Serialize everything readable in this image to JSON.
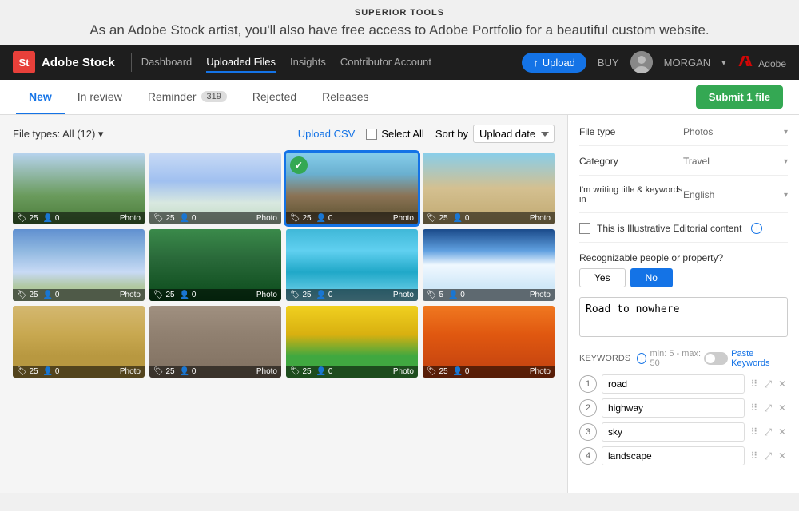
{
  "brand": {
    "title": "SUPERIOR TOOLS",
    "tagline": "As an Adobe Stock artist, you'll also have free access to Adobe Portfolio for a beautiful custom website.",
    "app_logo": "St",
    "app_name": "Adobe Stock",
    "adobe_label": "Adobe"
  },
  "navbar": {
    "links": [
      {
        "label": "Dashboard",
        "active": false
      },
      {
        "label": "Uploaded Files",
        "active": true
      },
      {
        "label": "Insights",
        "active": false
      },
      {
        "label": "Contributor Account",
        "active": false
      }
    ],
    "upload_btn": "Upload",
    "buy_label": "BUY",
    "user_name": "MORGAN"
  },
  "tabs": {
    "items": [
      {
        "label": "New",
        "active": true,
        "badge": null
      },
      {
        "label": "In review",
        "active": false,
        "badge": null
      },
      {
        "label": "Reminder",
        "active": false,
        "badge": "319"
      },
      {
        "label": "Rejected",
        "active": false,
        "badge": null
      },
      {
        "label": "Releases",
        "active": false,
        "badge": null
      }
    ],
    "submit_btn": "Submit 1 file"
  },
  "toolbar": {
    "file_types": "File types: All (12) ▾",
    "upload_csv": "Upload CSV",
    "select_all": "Select All",
    "sort_by": "Sort by",
    "sort_option": "Upload date"
  },
  "images": [
    {
      "id": 1,
      "color": "img-trees",
      "tags": 25,
      "people": 0,
      "type": "Photo"
    },
    {
      "id": 2,
      "color": "img-skydive",
      "tags": 25,
      "people": 0,
      "type": "Photo"
    },
    {
      "id": 3,
      "color": "img-road",
      "tags": 25,
      "people": 0,
      "type": "Photo",
      "selected": true,
      "checked": true
    },
    {
      "id": 4,
      "color": "img-desert",
      "tags": 25,
      "people": 0,
      "type": "Photo"
    },
    {
      "id": 5,
      "color": "img-clouds",
      "tags": 25,
      "people": 0,
      "type": "Photo"
    },
    {
      "id": 6,
      "color": "img-palms",
      "tags": 25,
      "people": 0,
      "type": "Photo"
    },
    {
      "id": 7,
      "color": "img-pool",
      "tags": 25,
      "people": 0,
      "type": "Photo"
    },
    {
      "id": 8,
      "color": "img-ski",
      "tags": 5,
      "people": 0,
      "type": "Photo"
    },
    {
      "id": 9,
      "color": "img-room",
      "tags": 25,
      "people": 0,
      "type": "Photo"
    },
    {
      "id": 10,
      "color": "img-stone",
      "tags": 25,
      "people": 0,
      "type": "Photo"
    },
    {
      "id": 11,
      "color": "img-yellow",
      "tags": 25,
      "people": 0,
      "type": "Photo"
    },
    {
      "id": 12,
      "color": "img-orange",
      "tags": 25,
      "people": 0,
      "type": "Photo"
    }
  ],
  "right_panel": {
    "file_type_label": "File type",
    "file_type_value": "Photos",
    "category_label": "Category",
    "category_value": "Travel",
    "lang_label": "I'm writing title & keywords in",
    "lang_value": "English",
    "editorial_label": "This is Illustrative Editorial content",
    "recognizable_label": "Recognizable people or property?",
    "yes_btn": "Yes",
    "no_btn": "No",
    "title_placeholder": "Road to nowhere",
    "keywords_label": "KEYWORDS",
    "keywords_hint": "min: 5 - max: 50",
    "paste_keywords": "Paste Keywords",
    "keywords": [
      {
        "num": 1,
        "value": "road"
      },
      {
        "num": 2,
        "value": "highway"
      },
      {
        "num": 3,
        "value": "sky"
      },
      {
        "num": 4,
        "value": "landscape"
      }
    ]
  }
}
